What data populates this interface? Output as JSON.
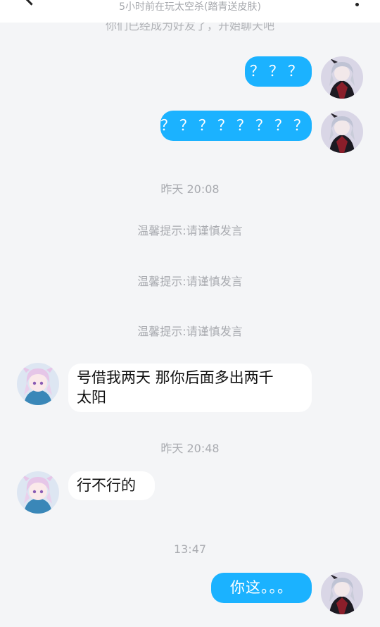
{
  "header": {
    "status": "5小时前在玩太空杀(踏青送皮肤)"
  },
  "friend_hint": "你们已经成为好友了，开始聊天吧",
  "messages": {
    "m1": "？？？",
    "m2": "？？？？？？？？",
    "ts1": "昨天 20:08",
    "tip1": "温馨提示:请谨慎发言",
    "tip2": "温馨提示:请谨慎发言",
    "tip3": "温馨提示:请谨慎发言",
    "m3_line1": "号借我两天 那你后面多出两千",
    "m3_line2": "太阳",
    "ts2": "昨天 20:48",
    "m4": "行不行的",
    "ts3": "13:47",
    "m5": "你这。。。"
  },
  "colors": {
    "my_bubble": "#1bb2ff",
    "other_bubble": "#ffffff",
    "background": "#f4f5f7"
  }
}
